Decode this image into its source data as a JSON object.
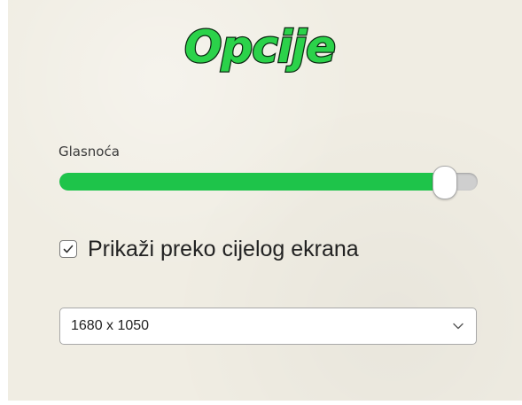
{
  "options": {
    "title": "Opcije",
    "volume": {
      "label": "Glasnoća",
      "level_percent": 92,
      "fill_color": "#1ec44a"
    },
    "fullscreen": {
      "label": "Prikaži preko cijelog ekrana",
      "checked": true
    },
    "resolution": {
      "selected": "1680 x 1050"
    }
  }
}
